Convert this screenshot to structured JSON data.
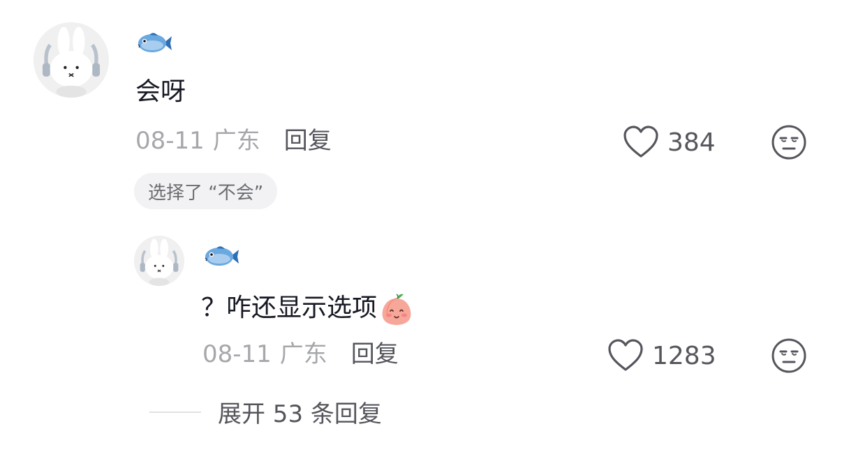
{
  "comment": {
    "avatar_icon": "bunny-avatar-icon",
    "username_icon": "fish-emoji-icon",
    "text": "会呀",
    "date": "08-11",
    "location": "广东",
    "reply_label": "回复",
    "like_count": "384",
    "choice_tag": "选择了 “不会”"
  },
  "reply": {
    "avatar_icon": "bunny-avatar-icon",
    "username_icon": "fish-emoji-icon",
    "text": "？咋还显示选项",
    "emoji_icon": "peach-emoji-icon",
    "date": "08-11",
    "location": "广东",
    "reply_label": "回复",
    "like_count": "1283"
  },
  "expand_label": "展开 53 条回复",
  "colors": {
    "text_primary": "#161823",
    "text_meta": "#a6a7ab",
    "text_secondary": "#55565c",
    "tag_bg": "#f2f2f4"
  }
}
